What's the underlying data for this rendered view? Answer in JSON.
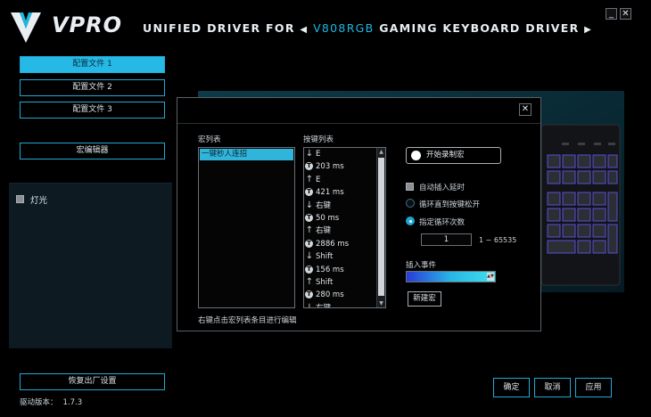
{
  "header": {
    "brand": "VPRO",
    "title_prefix": "UNIFIED DRIVER FOR",
    "model": "V808RGB",
    "title_suffix": "GAMING KEYBOARD DRIVER",
    "minimize_label": "_",
    "close_label": "✕"
  },
  "sidebar": {
    "profiles": [
      "配置文件 1",
      "配置文件 2",
      "配置文件 3"
    ],
    "macro_editor_label": "宏编辑器",
    "light_label": "灯光",
    "reset_label": "恢复出厂设置",
    "version_label": "驱动版本：",
    "version_value": "1.7.3"
  },
  "dialog": {
    "close_label": "✕",
    "macro_list_title": "宏列表",
    "macro_items": [
      "一键秒人连招"
    ],
    "key_list_title": "按键列表",
    "key_events": [
      {
        "icon": "down",
        "text": "E"
      },
      {
        "icon": "time",
        "text": "203 ms"
      },
      {
        "icon": "up",
        "text": "E"
      },
      {
        "icon": "time",
        "text": "421 ms"
      },
      {
        "icon": "down",
        "text": "右键"
      },
      {
        "icon": "time",
        "text": "50 ms"
      },
      {
        "icon": "up",
        "text": "右键"
      },
      {
        "icon": "time",
        "text": "2886 ms"
      },
      {
        "icon": "down",
        "text": "Shift"
      },
      {
        "icon": "time",
        "text": "156 ms"
      },
      {
        "icon": "up",
        "text": "Shift"
      },
      {
        "icon": "time",
        "text": "280 ms"
      },
      {
        "icon": "down",
        "text": "右键"
      }
    ],
    "hint": "右键点击宏列表条目进行编辑",
    "record_label": "开始录制宏",
    "auto_delay_label": "自动插入延时",
    "loop_until_release_label": "循环直到按键松开",
    "loop_count_label": "指定循环次数",
    "loop_count_value": "1",
    "loop_range": "1 ~ 65535",
    "insert_event_label": "插入事件",
    "new_macro_label": "新建宏"
  },
  "footer": {
    "ok_label": "确定",
    "cancel_label": "取消",
    "apply_label": "应用"
  },
  "colors": {
    "accent": "#26b9e6",
    "background": "#000000"
  }
}
